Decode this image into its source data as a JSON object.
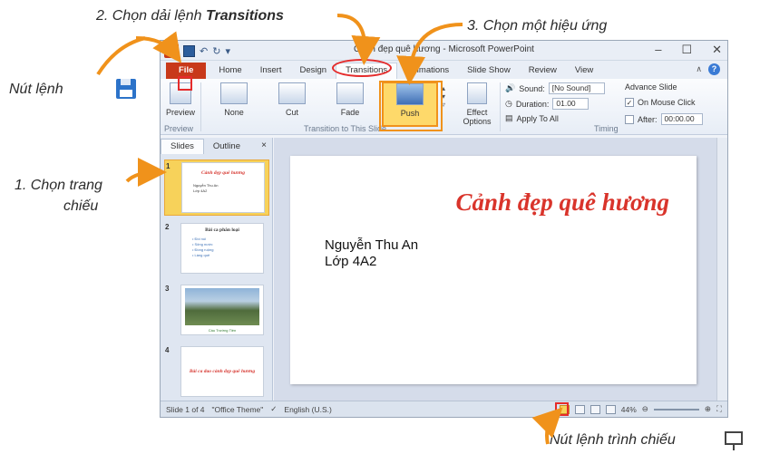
{
  "annotations": {
    "step2_prefix": "2. Chọn dải lệnh ",
    "step2_bold": "Transitions",
    "step3": "3. Chọn một hiệu ứng",
    "save_label": "Nút lệnh",
    "step1_line1": "1. Chọn trang",
    "step1_line2": "chiếu",
    "slideshow_label": "Nút lệnh trình chiếu"
  },
  "window": {
    "title": "Cảnh đẹp quê hương - Microsoft PowerPoint",
    "controls": [
      "–",
      "☐",
      "✕"
    ]
  },
  "tabs": [
    "File",
    "Home",
    "Insert",
    "Design",
    "Transitions",
    "Animations",
    "Slide Show",
    "Review",
    "View"
  ],
  "active_tab": "Transitions",
  "ribbon": {
    "preview_label": "Preview",
    "preview_group": "Preview",
    "transitions": [
      "None",
      "Cut",
      "Fade",
      "Push"
    ],
    "selected_transition": "Push",
    "effect_options": "Effect Options",
    "transition_group": "Transition to This Slide",
    "sound_label": "Sound:",
    "sound_value": "[No Sound]",
    "duration_label": "Duration:",
    "duration_value": "01.00",
    "apply_all": "Apply To All",
    "advance_label": "Advance Slide",
    "on_mouse_click": "On Mouse Click",
    "on_mouse_click_checked": true,
    "after_label": "After:",
    "after_value": "00:00.00",
    "timing_group": "Timing"
  },
  "pane": {
    "tabs": [
      "Slides",
      "Outline"
    ],
    "close": "×",
    "slides": [
      {
        "num": "1",
        "title": "Cảnh đẹp quê hương",
        "lines": [
          "Nguyễn Thu An",
          "Lớp 4A2"
        ]
      },
      {
        "num": "2",
        "title": "Bài ca phân loại",
        "lines": [
          "•  Đồi núi",
          "•  Sông nước",
          "•  Đồng ruộng",
          "•  Làng quê"
        ]
      },
      {
        "num": "3",
        "caption": "Cầu Trường Tiền"
      },
      {
        "num": "4",
        "title": "Bài ca dao cảnh đẹp quê hương"
      }
    ]
  },
  "slide": {
    "title": "Cảnh đẹp quê hương",
    "line1": "Nguyễn Thu An",
    "line2": "Lớp 4A2"
  },
  "status": {
    "slide_info": "Slide 1 of 4",
    "theme": "\"Office Theme\"",
    "language": "English (U.S.)",
    "zoom": "44%"
  },
  "colors": {
    "accent_orange": "#f0921b",
    "highlight_red": "#e52b2b",
    "file_tab": "#c8391a"
  }
}
